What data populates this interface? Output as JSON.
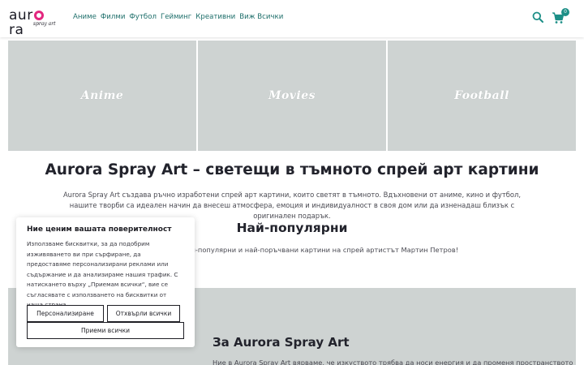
{
  "brand": {
    "logo_pre": "aur",
    "logo_post": "ra",
    "logo_sub": "spray art",
    "accent": "#1d8f87"
  },
  "nav": {
    "items": [
      "Аниме",
      "Филми",
      "Футбол",
      "Гейминг",
      "Креативни",
      "Виж Всички"
    ]
  },
  "header": {
    "cart_count": "0"
  },
  "tiles": [
    {
      "label": "Anime"
    },
    {
      "label": "Movies"
    },
    {
      "label": "Football"
    }
  ],
  "hero": {
    "title": "Aurora Spray Art – светещи в тъмното спрей арт картини",
    "description": "Aurora Spray Art създава ръчно изработени спрей арт картини, които светят в тъмното. Вдъхновени от аниме, кино и футбол, нашите творби са идеален начин да внесеш атмосфера, емоция и индивидуалност в своя дом или да изненадаш близък с оригинален подарък."
  },
  "popular": {
    "title": "Най-популярни",
    "description": "най-популярни и най-поръчвани картини на спрей артистът Мартин Петров!"
  },
  "about": {
    "title": "За Aurora Spray Art",
    "text": "Ние в Aurora Spray Art вярваме, че изкуството трябва да носи енергия и да променя пространството"
  },
  "cookie": {
    "title": "Ние ценим вашата поверителност",
    "text": "Използваме бисквитки, за да подобрим изживяването ви при сърфиране, да предоставяме персонализирани реклами или съдържание и да анализираме нашия трафик. С натискането върху „Приемам всички“, вие се съгласявате с използването на бисквитки от наша страна.",
    "customize_label": "Персонализиране",
    "reject_label": "Отхвърли всички",
    "accept_label": "Приеми всички"
  }
}
